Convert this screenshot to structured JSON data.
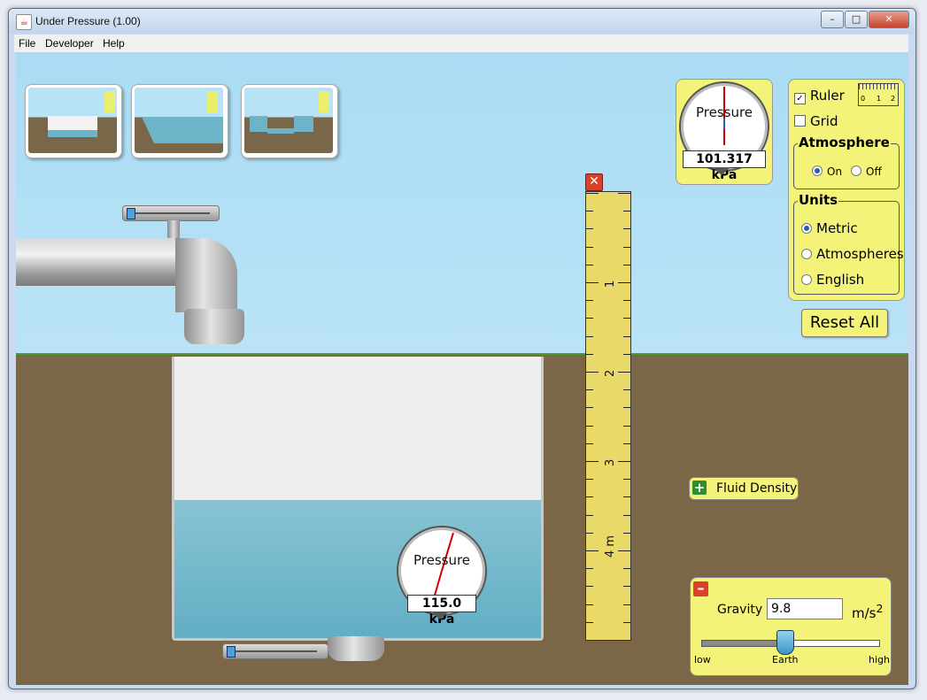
{
  "window": {
    "title": "Under Pressure (1.00)",
    "minimize": "–",
    "maximize": "□",
    "close": "✕"
  },
  "menu": {
    "file": "File",
    "developer": "Developer",
    "help": "Help"
  },
  "atm_gauge": {
    "title": "Pressure",
    "value": "101.317 kPa"
  },
  "pool_gauge": {
    "title": "Pressure",
    "value": "115.0 kPa"
  },
  "controls": {
    "ruler_label": "Ruler",
    "ruler_checked": true,
    "grid_label": "Grid",
    "grid_checked": false,
    "atmosphere": {
      "title": "Atmosphere",
      "on": "On",
      "off": "Off",
      "selected": "On"
    },
    "units": {
      "title": "Units",
      "options": [
        "Metric",
        "Atmospheres",
        "English"
      ],
      "selected": "Metric"
    },
    "mini_ruler_labels": [
      "0",
      "1",
      "2"
    ]
  },
  "reset_all": "Reset All",
  "ruler": {
    "labels": [
      "1",
      "2",
      "3",
      "4 m"
    ],
    "close": "✕"
  },
  "fluid_density": {
    "label": "Fluid Density",
    "icon": "+"
  },
  "gravity": {
    "label": "Gravity",
    "value": "9.8",
    "unit": "m/s",
    "unit_sup": "2",
    "low": "low",
    "earth": "Earth",
    "high": "high",
    "icon": "–",
    "level_fraction": 0.47
  },
  "colors": {
    "panel": "#f3f37a",
    "water": "#6db4c8",
    "ground": "#7b6748",
    "sky": "#b8e2f5"
  }
}
